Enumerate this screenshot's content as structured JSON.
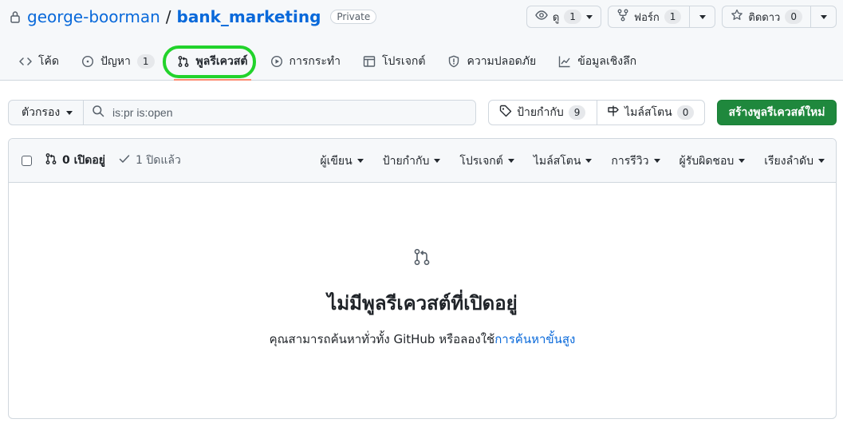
{
  "repo": {
    "owner": "george-boorman",
    "separator": "/",
    "name": "bank_marketing",
    "visibility": "Private"
  },
  "actions": {
    "watch": {
      "label": "ดู",
      "count": "1"
    },
    "fork": {
      "label": "ฟอร์ก",
      "count": "1"
    },
    "star": {
      "label": "ติดดาว",
      "count": "0"
    }
  },
  "tabs": [
    {
      "label": "โค้ด",
      "icon": "code-icon"
    },
    {
      "label": "ปัญหา",
      "icon": "issue-icon",
      "count": "1"
    },
    {
      "label": "พูลรีเควสต์",
      "icon": "git-pull-request-icon",
      "active": true
    },
    {
      "label": "การกระทำ",
      "icon": "play-icon"
    },
    {
      "label": "โปรเจกต์",
      "icon": "table-icon"
    },
    {
      "label": "ความปลอดภัย",
      "icon": "shield-icon"
    },
    {
      "label": "ข้อมูลเชิงลึก",
      "icon": "graph-icon"
    }
  ],
  "filters": {
    "filter_label": "ตัวกรอง",
    "search_value": "is:pr is:open",
    "labels": {
      "label": "ป้ายกำกับ",
      "count": "9"
    },
    "milestones": {
      "label": "ไมล์สโตน",
      "count": "0"
    },
    "new_pr_label": "สร้างพูลรีเควสต์ใหม่"
  },
  "list_header": {
    "open_label": "0 เปิดอยู่",
    "closed_label": "1 ปิดแล้ว",
    "sorts": [
      "ผู้เขียน",
      "ป้ายกำกับ",
      "โปรเจกต์",
      "ไมล์สโตน",
      "การรีวิว",
      "ผู้รับผิดชอบ",
      "เรียงลำดับ"
    ]
  },
  "blankslate": {
    "title": "ไม่มีพูลรีเควสต์ที่เปิดอยู่",
    "description": "คุณสามารถค้นหาทั่วทั้ง GitHub หรือลองใช้",
    "link": "การค้นหาขั้นสูง"
  },
  "colors": {
    "accent": "#0969da",
    "primary_button": "#1f883d",
    "highlight": "#22d32b",
    "active_underline": "#fd8c73"
  }
}
